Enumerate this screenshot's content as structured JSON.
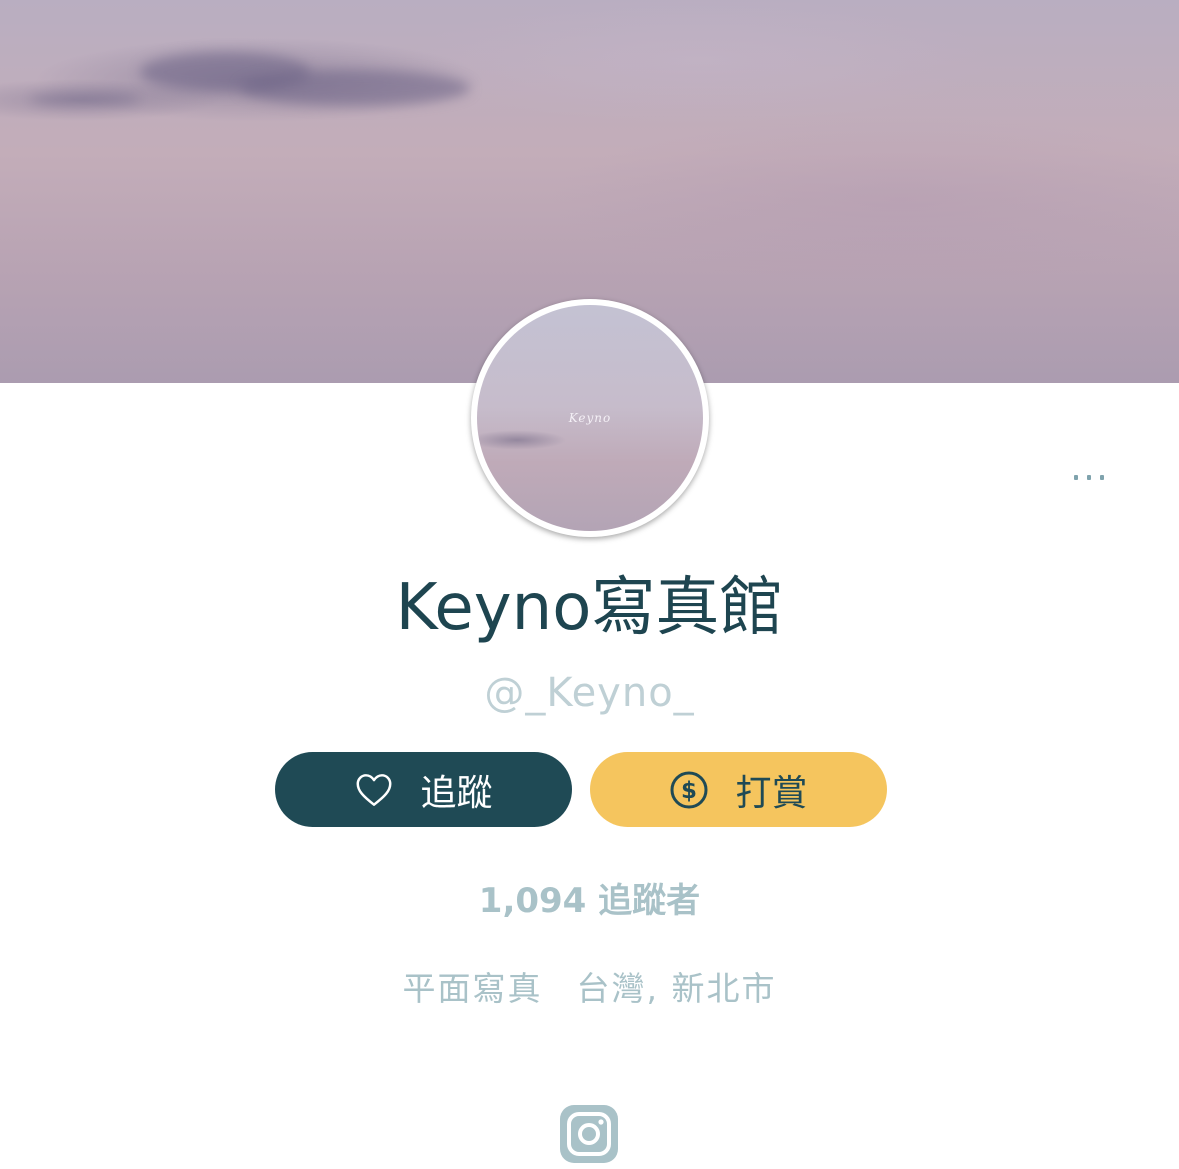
{
  "cover": {
    "icon": "cover-photo-sky"
  },
  "avatar": {
    "text": "Keyno"
  },
  "profile": {
    "name": "Keyno寫真館",
    "handle": "@_Keyno_",
    "followers": "1,094 追蹤者",
    "category": "平面寫真",
    "location": "台灣, 新北市"
  },
  "buttons": {
    "follow_label": "追蹤",
    "follow_icon": "heart-outline-icon",
    "tip_label": "打賞",
    "tip_icon": "dollar-circle-icon",
    "more_icon": "more-dots-icon"
  },
  "social": {
    "instagram_icon": "instagram-icon"
  },
  "colors": {
    "primary": "#1f4a55",
    "accent": "#f5c55e",
    "muted": "#a9c2c8"
  }
}
